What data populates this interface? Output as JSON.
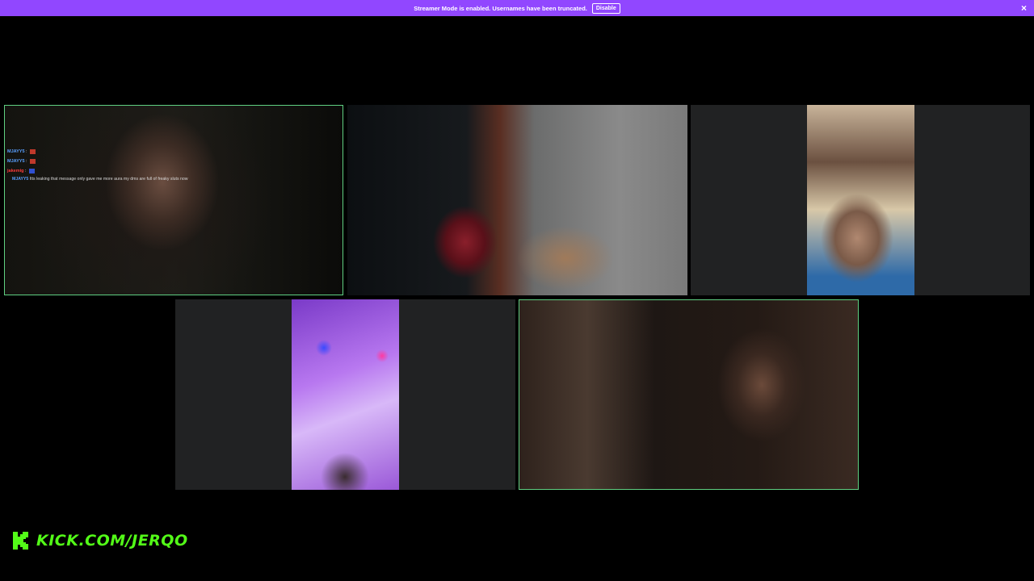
{
  "banner": {
    "message": "Streamer Mode is enabled. Usernames have been truncated.",
    "disable_label": "Disable",
    "close_icon": "×",
    "color": "#9147ff"
  },
  "chat": {
    "lines": [
      {
        "user": "MJAYY5",
        "sep": ":",
        "user_color": "#5aa0ff"
      },
      {
        "user": "MJAYY5",
        "sep": ":",
        "user_color": "#5aa0ff"
      },
      {
        "user": "jakemig",
        "sep": ":",
        "user_color": "#ff3b3b"
      }
    ],
    "reply": {
      "user": "MJAYY5",
      "text": "Itts leaking that message only gave me more aura my dms are full of freaky sluts now"
    }
  },
  "tiles": [
    {
      "id": "tile-1",
      "active": true
    },
    {
      "id": "tile-2",
      "active": false
    },
    {
      "id": "tile-3",
      "active": false
    },
    {
      "id": "tile-4",
      "active": false
    },
    {
      "id": "tile-5",
      "active": true
    }
  ],
  "watermark": {
    "text": "KICK.COM/JERQO",
    "color": "#53fc18",
    "icon": "kick-logo-icon"
  }
}
